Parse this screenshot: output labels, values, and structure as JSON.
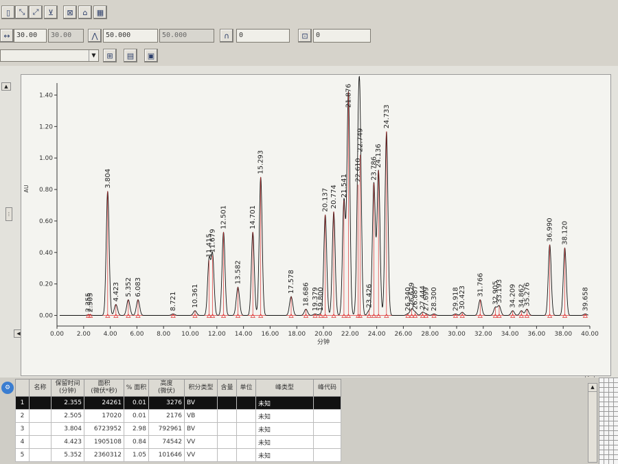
{
  "toolbar": {
    "row2": {
      "field1": "30.00",
      "field2": "30.00",
      "field3": "50.000",
      "field4": "50.000",
      "field5": "0",
      "field6": "0"
    }
  },
  "chart_data": {
    "type": "line",
    "xlabel": "分钟",
    "ylabel": "AU",
    "xlim": [
      0,
      40
    ],
    "ylim": [
      -0.05,
      1.45
    ],
    "xticks": [
      "0.00",
      "2.00",
      "4.00",
      "6.00",
      "8.00",
      "10.00",
      "12.00",
      "14.00",
      "16.00",
      "18.00",
      "20.00",
      "22.00",
      "24.00",
      "26.00",
      "28.00",
      "30.00",
      "32.00",
      "34.00",
      "36.00",
      "38.00",
      "40.00"
    ],
    "yticks": [
      "0.00",
      "0.20",
      "0.40",
      "0.60",
      "0.80",
      "1.00",
      "1.20",
      "1.40"
    ],
    "peaks": [
      {
        "rt": 2.355,
        "label": "2.355",
        "h": 0.003
      },
      {
        "rt": 2.505,
        "label": "2.505",
        "h": 0.002
      },
      {
        "rt": 3.804,
        "label": "3.804",
        "h": 0.79
      },
      {
        "rt": 4.423,
        "label": "4.423",
        "h": 0.07
      },
      {
        "rt": 5.352,
        "label": "5.352",
        "h": 0.1
      },
      {
        "rt": 6.083,
        "label": "6.083",
        "h": 0.1
      },
      {
        "rt": 8.721,
        "label": "8.721",
        "h": 0.01
      },
      {
        "rt": 10.361,
        "label": "10.361",
        "h": 0.03
      },
      {
        "rt": 11.415,
        "label": "11.415",
        "h": 0.35
      },
      {
        "rt": 11.679,
        "label": "11.679",
        "h": 0.38
      },
      {
        "rt": 12.501,
        "label": "12.501",
        "h": 0.53
      },
      {
        "rt": 13.582,
        "label": "13.582",
        "h": 0.18
      },
      {
        "rt": 14.701,
        "label": "14.701",
        "h": 0.53
      },
      {
        "rt": 15.293,
        "label": "15.293",
        "h": 0.88
      },
      {
        "rt": 17.578,
        "label": "17.578",
        "h": 0.12
      },
      {
        "rt": 18.686,
        "label": "18.686",
        "h": 0.04
      },
      {
        "rt": 19.379,
        "label": "19.379",
        "h": 0.01
      },
      {
        "rt": 19.8,
        "label": "19.800",
        "h": 0.01
      },
      {
        "rt": 20.137,
        "label": "20.137",
        "h": 0.64
      },
      {
        "rt": 20.774,
        "label": "20.774",
        "h": 0.66
      },
      {
        "rt": 21.541,
        "label": "21.541",
        "h": 0.73
      },
      {
        "rt": 21.876,
        "label": "21.876",
        "h": 1.42
      },
      {
        "rt": 22.61,
        "label": "22.610",
        "h": 0.83
      },
      {
        "rt": 22.749,
        "label": "22.749",
        "h": 1.02
      },
      {
        "rt": 23.426,
        "label": "23.426",
        "h": 0.03
      },
      {
        "rt": 23.786,
        "label": "23.786",
        "h": 0.84
      },
      {
        "rt": 24.136,
        "label": "24.136",
        "h": 0.92
      },
      {
        "rt": 24.733,
        "label": "24.733",
        "h": 1.17
      },
      {
        "rt": 26.34,
        "label": "26.340",
        "h": 0.01
      },
      {
        "rt": 26.629,
        "label": "26.629",
        "h": 0.04
      },
      {
        "rt": 26.887,
        "label": "26.887",
        "h": 0.02
      },
      {
        "rt": 27.444,
        "label": "27.444",
        "h": 0.02
      },
      {
        "rt": 27.699,
        "label": "27.699",
        "h": 0.01
      },
      {
        "rt": 28.3,
        "label": "28.300",
        "h": 0.01
      },
      {
        "rt": 29.918,
        "label": "29.918",
        "h": 0.01
      },
      {
        "rt": 30.423,
        "label": "30.423",
        "h": 0.02
      },
      {
        "rt": 31.766,
        "label": "31.766",
        "h": 0.1
      },
      {
        "rt": 32.905,
        "label": "32.905",
        "h": 0.05
      },
      {
        "rt": 33.193,
        "label": "33.193",
        "h": 0.06
      },
      {
        "rt": 34.209,
        "label": "34.209",
        "h": 0.03
      },
      {
        "rt": 34.862,
        "label": "34.862",
        "h": 0.03
      },
      {
        "rt": 35.276,
        "label": "35.276",
        "h": 0.04
      },
      {
        "rt": 36.99,
        "label": "36.990",
        "h": 0.45
      },
      {
        "rt": 38.12,
        "label": "38.120",
        "h": 0.43
      },
      {
        "rt": 39.658,
        "label": "39.658",
        "h": 0.01
      }
    ]
  },
  "table": {
    "headers": [
      "名称",
      "保留时间\n(分钟)",
      "面积\n(微伏*秒)",
      "% 面积",
      "高度\n(微伏)",
      "积分类型",
      "含量",
      "单位",
      "峰类型",
      "峰代码"
    ],
    "rows": [
      {
        "no": "1",
        "name": "",
        "rt": "2.355",
        "area": "24261",
        "pct": "0.01",
        "height": "3276",
        "type": "BV",
        "content": "",
        "unit": "",
        "peak": "未知",
        "code": ""
      },
      {
        "no": "2",
        "name": "",
        "rt": "2.505",
        "area": "17020",
        "pct": "0.01",
        "height": "2176",
        "type": "VB",
        "content": "",
        "unit": "",
        "peak": "未知",
        "code": ""
      },
      {
        "no": "3",
        "name": "",
        "rt": "3.804",
        "area": "6723952",
        "pct": "2.98",
        "height": "792961",
        "type": "BV",
        "content": "",
        "unit": "",
        "peak": "未知",
        "code": ""
      },
      {
        "no": "4",
        "name": "",
        "rt": "4.423",
        "area": "1905108",
        "pct": "0.84",
        "height": "74542",
        "type": "VV",
        "content": "",
        "unit": "",
        "peak": "未知",
        "code": ""
      },
      {
        "no": "5",
        "name": "",
        "rt": "5.352",
        "area": "2360312",
        "pct": "1.05",
        "height": "101646",
        "type": "VV",
        "content": "",
        "unit": "",
        "peak": "未知",
        "code": ""
      }
    ]
  }
}
